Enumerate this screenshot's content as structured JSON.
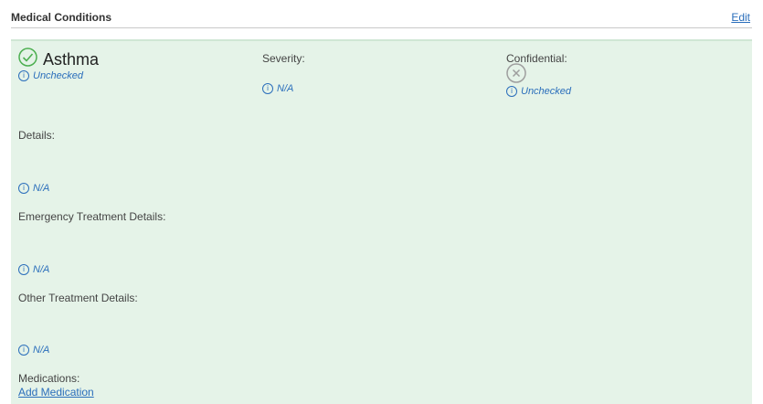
{
  "header": {
    "title": "Medical Conditions",
    "edit_label": "Edit"
  },
  "condition": {
    "name": "Asthma",
    "name_status": "Unchecked",
    "severity_label": "Severity:",
    "severity_value": "N/A",
    "confidential_label": "Confidential:",
    "confidential_status": "Unchecked",
    "details_label": "Details:",
    "details_value": "N/A",
    "emergency_label": "Emergency Treatment Details:",
    "emergency_value": "N/A",
    "other_label": "Other Treatment Details:",
    "other_value": "N/A",
    "medications_label": "Medications:",
    "add_medication_label": "Add Medication"
  },
  "colors": {
    "accent": "#2a6ebb",
    "card_bg": "#e5f3e8",
    "check": "#4caf50"
  }
}
